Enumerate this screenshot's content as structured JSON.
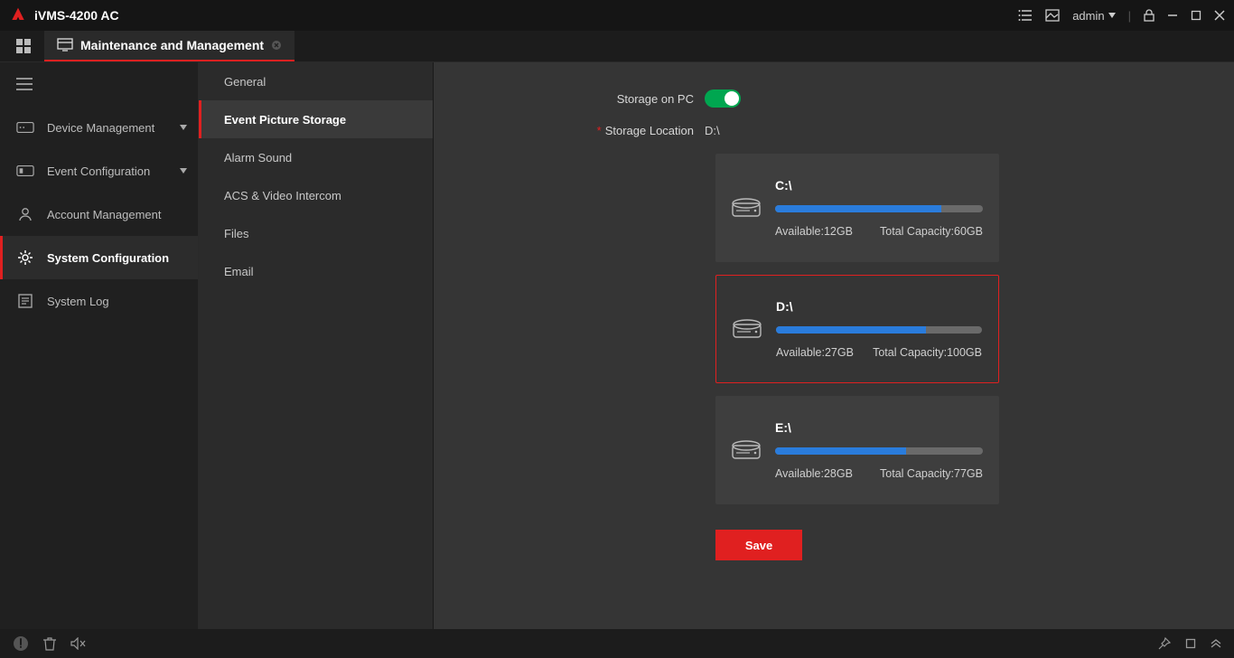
{
  "app": {
    "title": "iVMS-4200 AC",
    "user": "admin"
  },
  "tab": {
    "label": "Maintenance and Management"
  },
  "sidebar": {
    "items": [
      {
        "label": "Device Management",
        "expandable": true
      },
      {
        "label": "Event Configuration",
        "expandable": true
      },
      {
        "label": "Account Management",
        "expandable": false
      },
      {
        "label": "System Configuration",
        "expandable": false
      },
      {
        "label": "System Log",
        "expandable": false
      }
    ],
    "active_index": 3
  },
  "subnav": {
    "items": [
      {
        "label": "General"
      },
      {
        "label": "Event Picture Storage"
      },
      {
        "label": "Alarm Sound"
      },
      {
        "label": "ACS & Video Intercom"
      },
      {
        "label": "Files"
      },
      {
        "label": "Email"
      }
    ],
    "active_index": 1
  },
  "form": {
    "storage_on_pc_label": "Storage on PC",
    "storage_on_pc": true,
    "storage_location_label": "Storage Location",
    "storage_location_value": "D:\\"
  },
  "drives": [
    {
      "name": "C:\\",
      "available": "12GB",
      "total": "60GB",
      "used_pct": 80,
      "selected": false
    },
    {
      "name": "D:\\",
      "available": "27GB",
      "total": "100GB",
      "used_pct": 73,
      "selected": true
    },
    {
      "name": "E:\\",
      "available": "28GB",
      "total": "77GB",
      "used_pct": 63,
      "selected": false
    }
  ],
  "labels": {
    "available": "Available:",
    "total_capacity": "Total Capacity:",
    "save": "Save"
  }
}
